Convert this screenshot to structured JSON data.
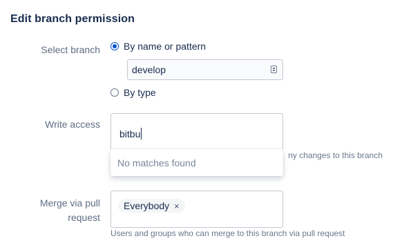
{
  "page": {
    "title": "Edit branch permission"
  },
  "select_branch": {
    "label": "Select branch",
    "option_name": "By name or pattern",
    "option_type": "By type",
    "pattern_value": "develop",
    "selected": "By name or pattern"
  },
  "write_access": {
    "label": "Write access",
    "typed_value": "bitbu",
    "dropdown_message": "No matches found",
    "help_partial": "ny changes to this branch"
  },
  "merge": {
    "label_line1": "Merge via pull",
    "label_line2": "request",
    "tags": [
      "Everybody"
    ],
    "tag_remove_glyph": "×",
    "help": "Users and groups who can merge to this branch via pull request"
  },
  "colors": {
    "accent": "#0052CC",
    "text": "#172B4D",
    "label": "#5E6C84",
    "border": "#C1C7D0"
  },
  "icons": {
    "pattern_field": "branch-list-icon",
    "tag_remove": "close-icon"
  }
}
